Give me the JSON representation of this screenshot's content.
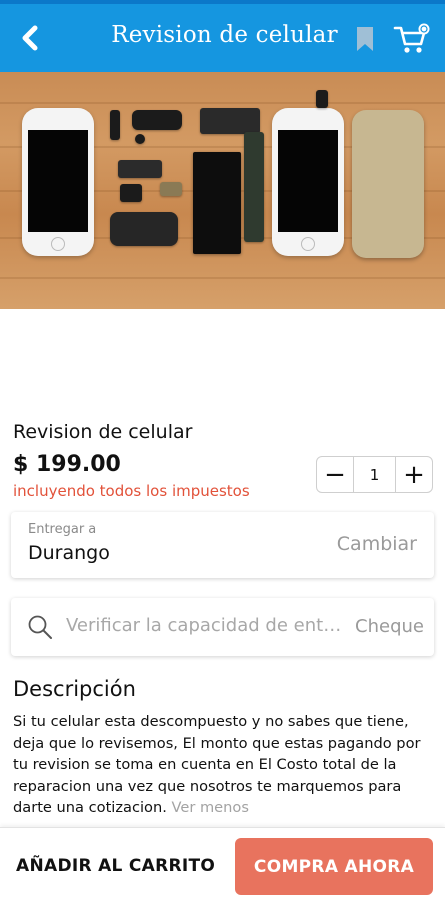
{
  "app_bar": {
    "title": "Revision de celular",
    "back_icon": "chevron-left-icon",
    "bookmark_icon": "bookmark-icon",
    "cart_icon": "cart-icon",
    "background_color": "#1596e0"
  },
  "hero": {
    "image_subject": "disassembled-phone-parts-on-wood"
  },
  "product": {
    "title": "Revision de celular",
    "price": "$ 199.00",
    "tax_note": "incluyendo todos los impuestos",
    "quantity": "1",
    "decrement_label": "−",
    "increment_label": "+"
  },
  "delivery": {
    "label": "Entregar a",
    "city": "Durango",
    "change_label": "Cambiar"
  },
  "availability": {
    "placeholder": "Verificar la capacidad de entrega",
    "check_label": "Cheque"
  },
  "description": {
    "title": "Descripción",
    "body": "Si tu celular esta descompuesto y no sabes que tiene, deja que lo revisemos, El monto que estas pagando por tu revision se toma en cuenta en El Costo total de la reparacion una vez que nosotros te marquemos para darte una cotizacion.",
    "see_less": "Ver menos"
  },
  "actions": {
    "add_to_cart": "AÑADIR AL CARRITO",
    "buy_now": "COMPRA AHORA",
    "accent_color": "#e8735e"
  }
}
